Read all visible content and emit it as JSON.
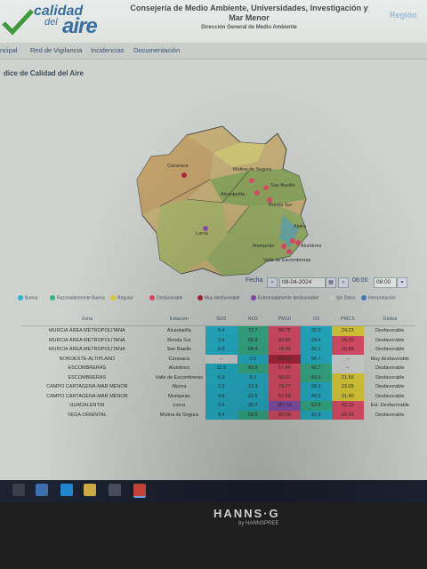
{
  "header": {
    "logo_top": "calidad",
    "logo_del": "del",
    "logo_aire": "aire",
    "title_line1": "Consejería de Medio Ambiente, Universidades, Investigación y Mar Menor",
    "title_line2": "Dirección General de Medio Ambiente",
    "region": "Región"
  },
  "nav": [
    "ncipal",
    "Red de Vigilancia",
    "Incidencias",
    "Documentación"
  ],
  "section_title": "dice de Calidad del Aire",
  "map": {
    "stations": [
      "Caravaca",
      "Molina de Segura",
      "San Basilio",
      "Alcantarilla",
      "Ronda Sur",
      "Lorca",
      "Alumbres",
      "Alpira",
      "Mompeán",
      "Valle de Escombreras"
    ]
  },
  "date_controls": {
    "fecha_label": "Fecha",
    "date_value": "08-04-2024",
    "hora_label": "Hora",
    "hour_value": "08:00"
  },
  "legend": [
    {
      "label": "Buena",
      "color": "#27b7cf"
    },
    {
      "label": "Razonablemente Buena",
      "color": "#37b48d"
    },
    {
      "label": "Regular",
      "color": "#e2d23a"
    },
    {
      "label": "Desfavorable",
      "color": "#e4506b"
    },
    {
      "label": "Muy desfavorable",
      "color": "#b3263b"
    },
    {
      "label": "Extremadamente desfavorable",
      "color": "#8f55b6"
    },
    {
      "label": "Sin Datos",
      "color": "#d8dad8"
    },
    {
      "label": "Interpretación",
      "color": "#4b84c1"
    }
  ],
  "table": {
    "headers": [
      "Zona",
      "Estación",
      "SO2",
      "NO2",
      "PM10",
      "O3",
      "PM2.5",
      "Global"
    ],
    "rows": [
      {
        "zona": "MURCIA ÁREA METROPOLITANA",
        "estacion": "Alcantarilla",
        "so2": "5.4",
        "no2": "72.7",
        "pm10": "80.75",
        "o3": "35.9",
        "pm25": "24.23",
        "global": "Desfavorable"
      },
      {
        "zona": "MURCIA ÁREA METROPOLITANA",
        "estacion": "Ronda Sur",
        "so2": "3.6",
        "no2": "66.9",
        "pm10": "80.83",
        "o3": "39.4",
        "pm25": "26.20",
        "global": "Desfavorable"
      },
      {
        "zona": "MURCIA ÁREA METROPOLITANA",
        "estacion": "San Basilio",
        "so2": "6.5",
        "no2": "68.4",
        "pm10": "78.49",
        "o3": "36.1",
        "pm25": "26.88",
        "global": "Desfavorable"
      },
      {
        "zona": "NOROESTE-ALTIPLANO",
        "estacion": "Caravaca",
        "so2": "--",
        "no2": "3.5",
        "pm10": "106.61",
        "o3": "56.7",
        "pm25": "--",
        "global": "Muy desfavorable"
      },
      {
        "zona": "ESCOMBRERAS",
        "estacion": "Alumbres",
        "so2": "11.9",
        "no2": "49.9",
        "pm10": "57.46",
        "o3": "66.7",
        "pm25": "--",
        "global": "Desfavorable"
      },
      {
        "zona": "ESCOMBRERAS",
        "estacion": "Valle de Escombreras",
        "so2": "5.3",
        "no2": "8.3",
        "pm10": "56.52",
        "o3": "83.6",
        "pm25": "21.56",
        "global": "Desfavorable"
      },
      {
        "zona": "CAMPO CARTAGENA-MAR MENOR",
        "estacion": "Aljorra",
        "so2": "2.9",
        "no2": "12.3",
        "pm10": "73.77",
        "o3": "58.2",
        "pm25": "23.09",
        "global": "Desfavorable"
      },
      {
        "zona": "CAMPO CARTAGENA-MAR MENOR",
        "estacion": "Mompeán",
        "so2": "4.8",
        "no2": "22.5",
        "pm10": "57.29",
        "o3": "45.9",
        "pm25": "21.40",
        "global": "Desfavorable"
      },
      {
        "zona": "GUADALENTIN",
        "estacion": "Lorca",
        "so2": "2.4",
        "no2": "35.7",
        "pm10": "167.16",
        "o3": "62.8",
        "pm25": "42.19",
        "global": "Ext. Desfavorable"
      },
      {
        "zona": "VEGA-ORIENTAL",
        "estacion": "Molina de Segura",
        "so2": "8.4",
        "no2": "59.5",
        "pm10": "82.59",
        "o3": "42.9",
        "pm25": "25.94",
        "global": "Desfavorable"
      }
    ]
  },
  "monitor": {
    "brand": "HANNS·G",
    "sub": "by HANNSPREE"
  }
}
